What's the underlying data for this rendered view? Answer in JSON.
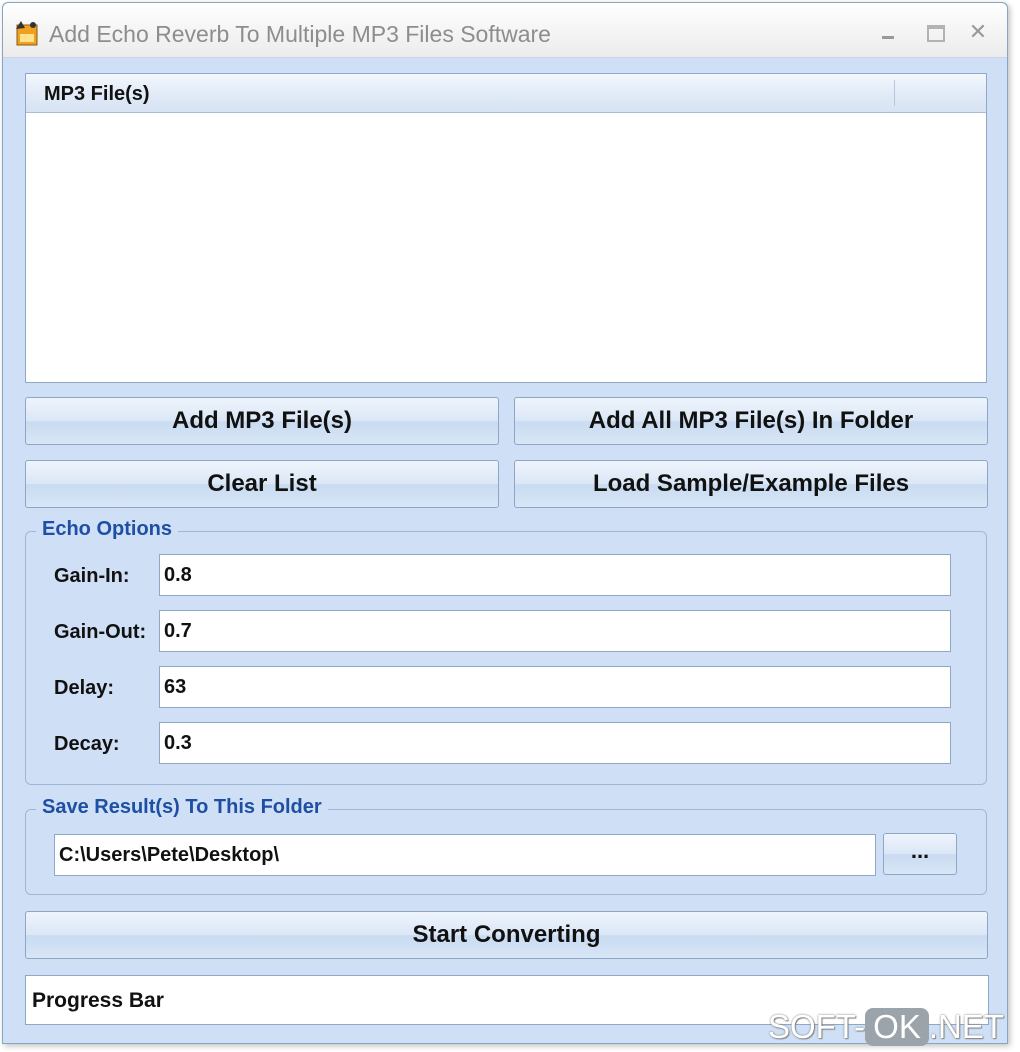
{
  "window": {
    "title": "Add Echo Reverb To Multiple MP3 Files Software",
    "controls": {
      "minimize": "minimize-icon",
      "maximize": "maximize-icon",
      "close": "✕"
    }
  },
  "file_list": {
    "column_header": "MP3 File(s)",
    "rows": []
  },
  "buttons": {
    "add_files": "Add MP3 File(s)",
    "add_folder": "Add All MP3 File(s) In Folder",
    "clear_list": "Clear List",
    "load_samples": "Load Sample/Example Files",
    "browse": "...",
    "start": "Start Converting"
  },
  "echo_options": {
    "title": "Echo Options",
    "gain_in": {
      "label": "Gain-In:",
      "value": "0.8"
    },
    "gain_out": {
      "label": "Gain-Out:",
      "value": "0.7"
    },
    "delay": {
      "label": "Delay:",
      "value": "63"
    },
    "decay": {
      "label": "Decay:",
      "value": "0.3"
    }
  },
  "save_folder": {
    "title": "Save Result(s) To This Folder",
    "path": "C:\\Users\\Pete\\Desktop\\"
  },
  "progress": {
    "label": "Progress Bar"
  },
  "watermark": {
    "prefix": "SOFT-",
    "middle": "OK",
    "suffix": ".NET"
  },
  "colors": {
    "window_bg": "#cfe0f6",
    "group_title": "#1f4fa3",
    "border": "#8fa8c8"
  }
}
